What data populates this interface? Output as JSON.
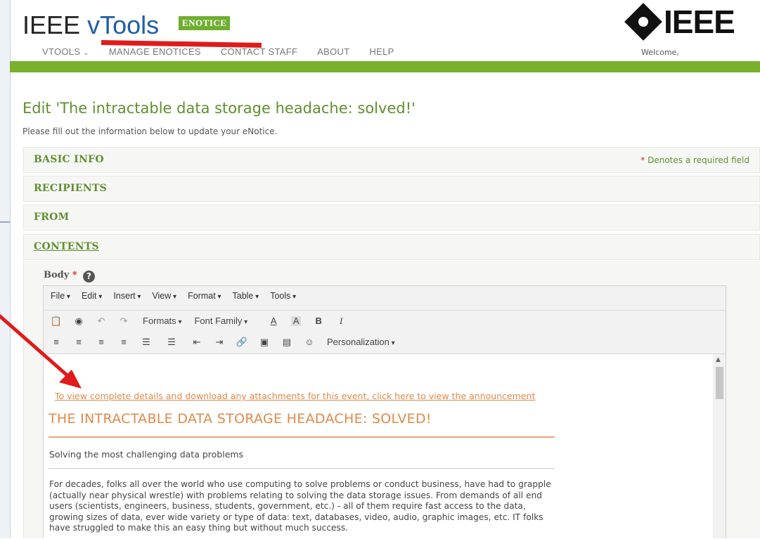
{
  "header": {
    "logo_prefix": "IEEE",
    "logo_product": "vTools",
    "badge": "ENOTICE",
    "brand": "IEEE",
    "welcome": "Welcome,"
  },
  "nav": {
    "items": [
      {
        "label": "VTOOLS"
      },
      {
        "label": "MANAGE ENOTICES"
      },
      {
        "label": "CONTACT STAFF"
      },
      {
        "label": "ABOUT"
      },
      {
        "label": "HELP"
      }
    ]
  },
  "page": {
    "title": "Edit 'The intractable data storage headache: solved!'",
    "subtitle": "Please fill out the information below to update your eNotice."
  },
  "sections": {
    "basic_info": "BASIC INFO",
    "required_note": "Denotes a required field",
    "recipients": "RECIPIENTS",
    "from": "FROM",
    "contents": "CONTENTS"
  },
  "body_field": {
    "label": "Body",
    "required_mark": "*",
    "help": "?"
  },
  "editor": {
    "menus": [
      "File",
      "Edit",
      "Insert",
      "View",
      "Format",
      "Table",
      "Tools"
    ],
    "formats": "Formats",
    "font_family": "Font Family",
    "bold": "B",
    "italic": "I",
    "personalization": "Personalization"
  },
  "content": {
    "link": "To view complete details and download any attachments for this event, click here to view the announcement",
    "heading": "THE INTRACTABLE DATA STORAGE HEADACHE: SOLVED!",
    "subheading": "Solving the most challenging data problems",
    "paragraph": "For decades, folks all over the world who use computing to solve problems or conduct business, have had to grapple (actually near physical wrestle) with problems relating to solving the data storage issues. From demands of all end users (scientists, engineers, business, students, government, etc.) - all of them require fast access to the data, growing sizes of data, ever wide variety or type of data: text, databases, video, audio, graphic images, etc. IT folks have struggled to make this an easy thing but without much success."
  },
  "colors": {
    "green": "#79b12c",
    "title_green": "#5f8f2f",
    "orange": "#e0894a",
    "annotation_red": "#e01b1b"
  }
}
